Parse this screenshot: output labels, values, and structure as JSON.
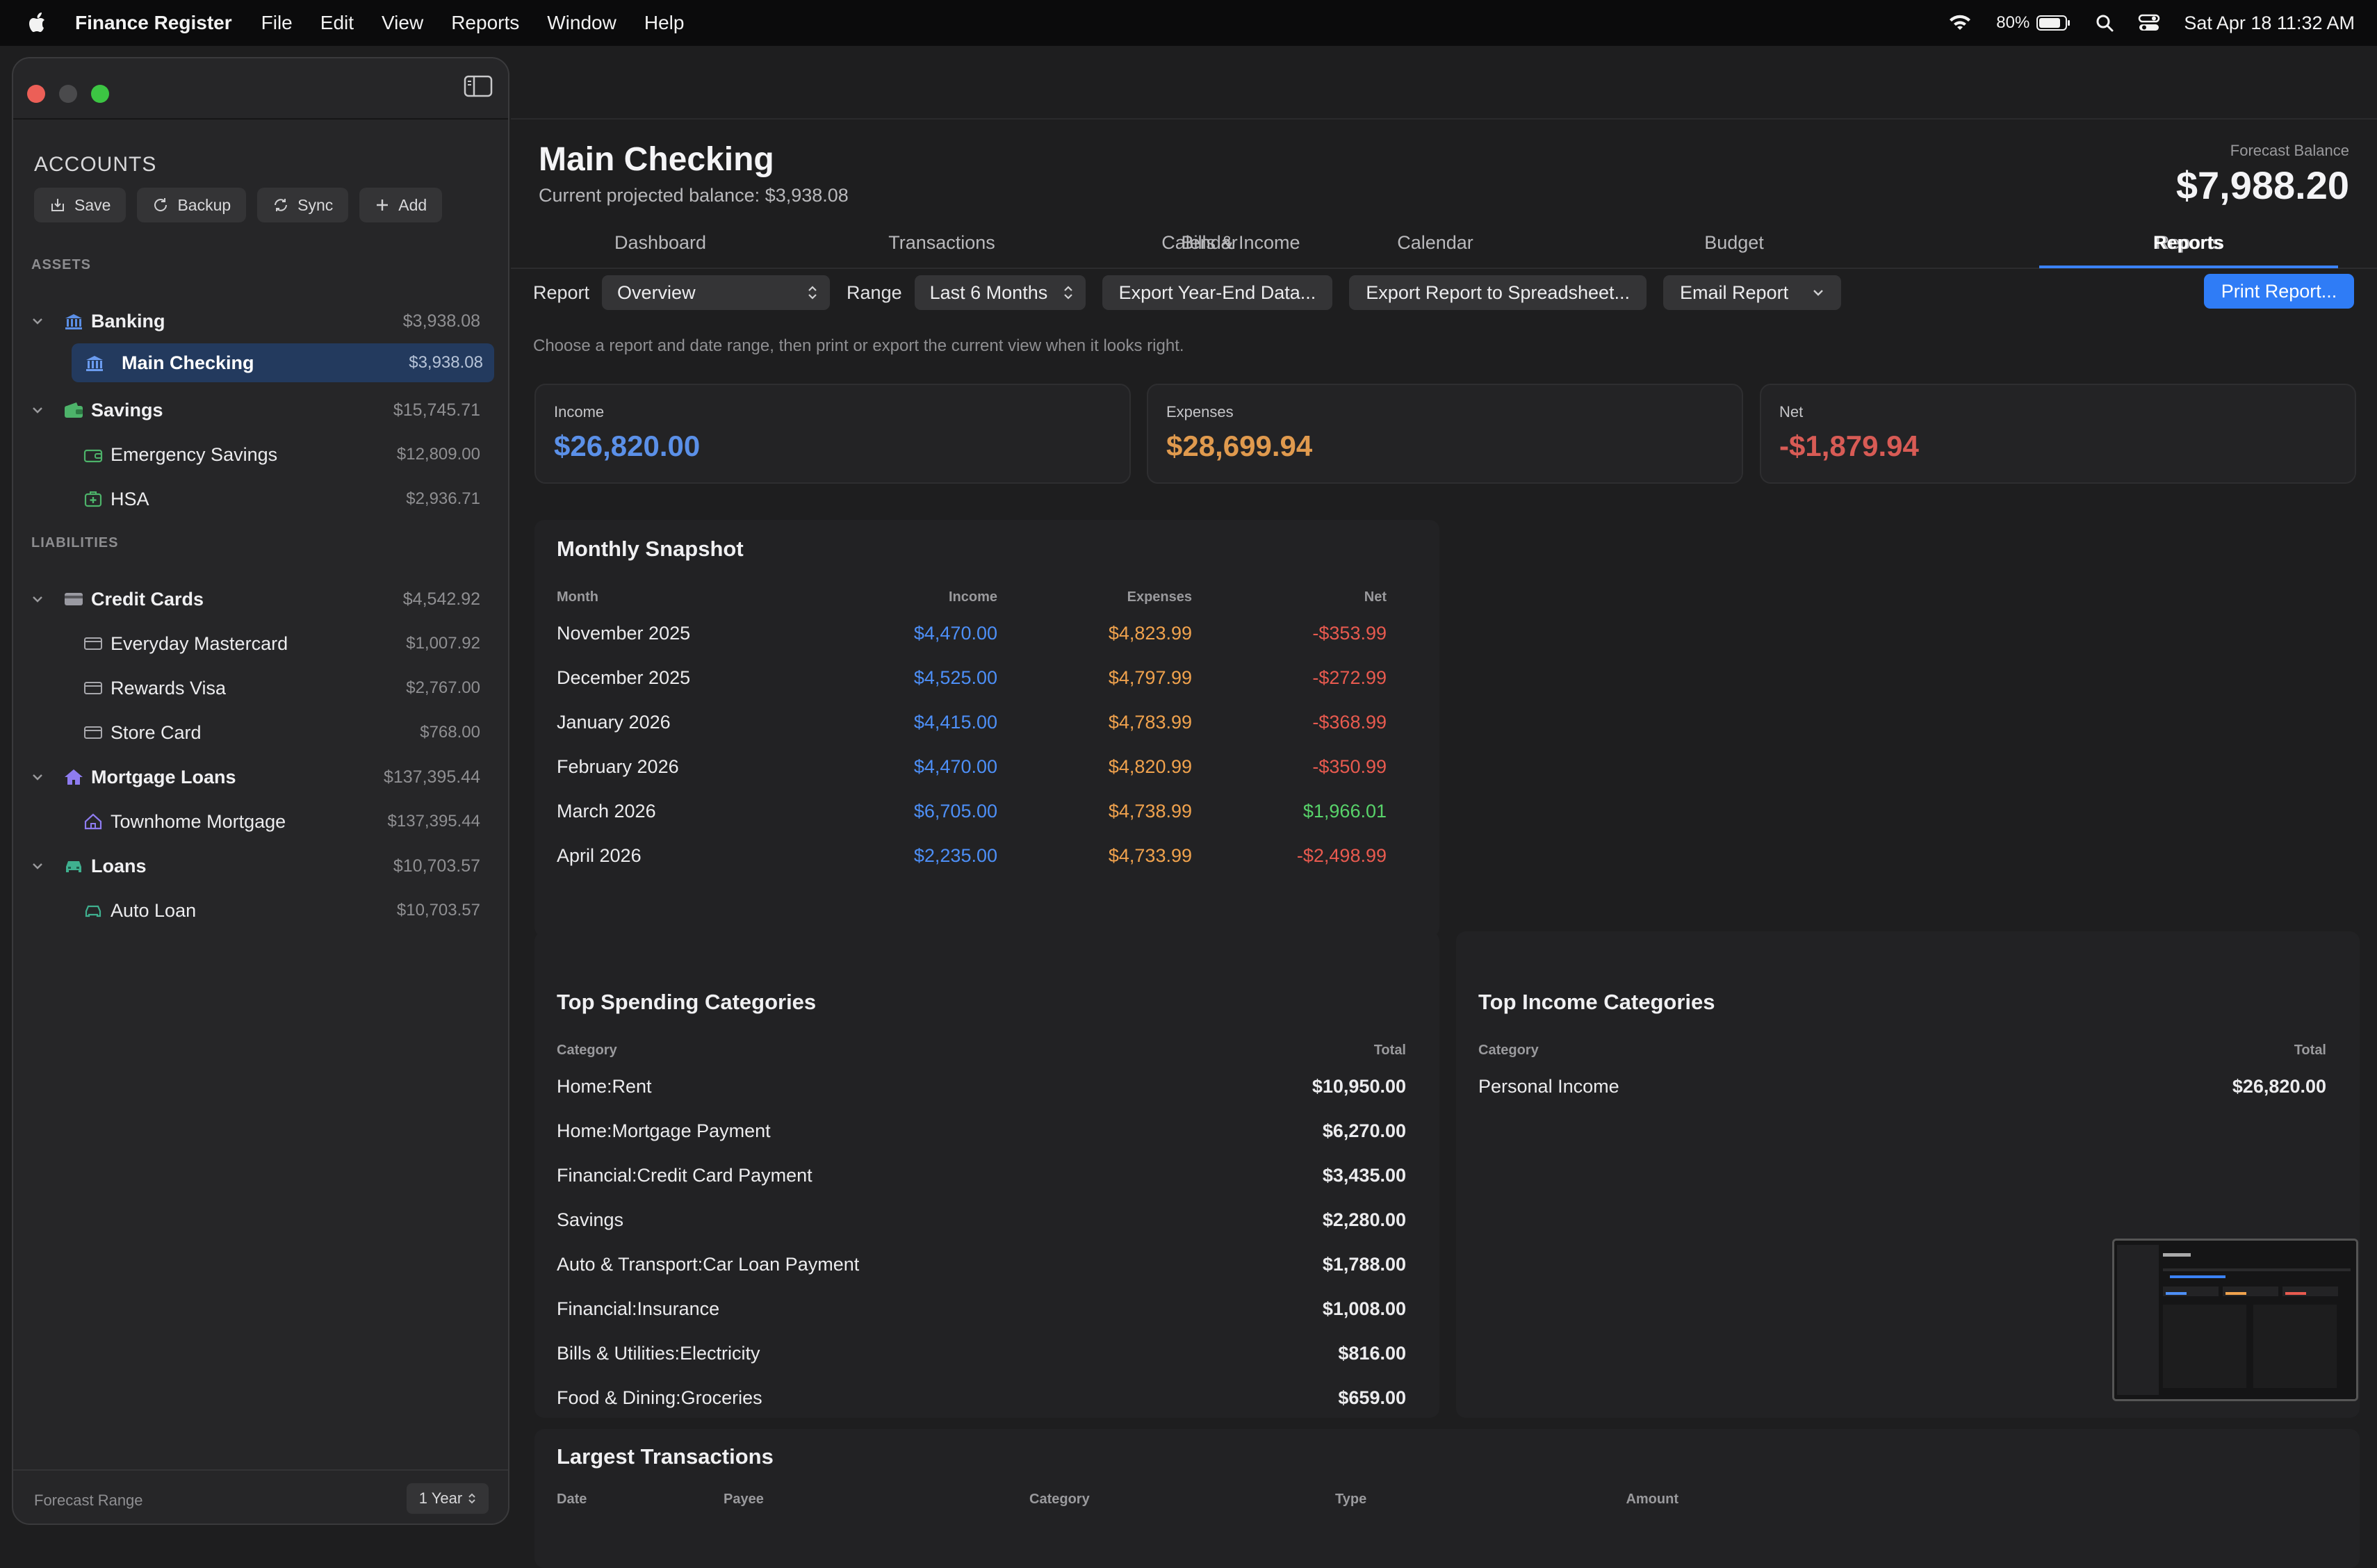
{
  "menubar": {
    "app_name": "Finance Register",
    "menus": [
      "File",
      "Edit",
      "View",
      "Reports",
      "Window",
      "Help"
    ],
    "battery": "80%",
    "datetime": "Sat Apr 18  11:32 AM"
  },
  "sidebar": {
    "title": "ACCOUNTS",
    "toolbar": {
      "save": "Save",
      "backup": "Backup",
      "sync": "Sync",
      "add": "Add"
    },
    "assets_label": "ASSETS",
    "liabilities_label": "LIABILITIES",
    "banking": {
      "label": "Banking",
      "amount": "$3,938.08"
    },
    "main_checking": {
      "label": "Main Checking",
      "amount": "$3,938.08"
    },
    "savings": {
      "label": "Savings",
      "amount": "$15,745.71"
    },
    "emergency_savings": {
      "label": "Emergency Savings",
      "amount": "$12,809.00"
    },
    "hsa": {
      "label": "HSA",
      "amount": "$2,936.71"
    },
    "credit_cards": {
      "label": "Credit Cards",
      "amount": "$4,542.92"
    },
    "everyday_mastercard": {
      "label": "Everyday Mastercard",
      "amount": "$1,007.92"
    },
    "rewards_visa": {
      "label": "Rewards Visa",
      "amount": "$2,767.00"
    },
    "store_card": {
      "label": "Store Card",
      "amount": "$768.00"
    },
    "mortgage_loans": {
      "label": "Mortgage Loans",
      "amount": "$137,395.44"
    },
    "townhome_mortgage": {
      "label": "Townhome Mortgage",
      "amount": "$137,395.44"
    },
    "loans": {
      "label": "Loans",
      "amount": "$10,703.57"
    },
    "auto_loan": {
      "label": "Auto Loan",
      "amount": "$10,703.57"
    },
    "forecast_range_label": "Forecast Range",
    "forecast_range_value": "1 Year"
  },
  "header": {
    "title": "Main Checking",
    "subtitle": "Current projected balance: $3,938.08",
    "forecast_label": "Forecast Balance",
    "forecast_value": "$7,988.20"
  },
  "tabs": [
    "Dashboard",
    "Transactions",
    "Bills & Income",
    "Calendar",
    "Budget",
    "Reports"
  ],
  "controls": {
    "report_label": "Report",
    "report_value": "Overview",
    "range_label": "Range",
    "range_value": "Last 6 Months",
    "export_year_end": "Export Year-End Data...",
    "export_spreadsheet": "Export Report to Spreadsheet...",
    "email_report": "Email Report",
    "print_report": "Print Report..."
  },
  "hint": "Choose a report and date range, then print or export the current view when it looks right.",
  "summary": {
    "income_label": "Income",
    "income_value": "$26,820.00",
    "expenses_label": "Expenses",
    "expenses_value": "$28,699.94",
    "net_label": "Net",
    "net_value": "-$1,879.94"
  },
  "monthly": {
    "title": "Monthly Snapshot",
    "headers": [
      "Month",
      "Income",
      "Expenses",
      "Net"
    ],
    "rows": [
      [
        "November 2025",
        "$4,470.00",
        "$4,823.99",
        "-$353.99"
      ],
      [
        "December 2025",
        "$4,525.00",
        "$4,797.99",
        "-$272.99"
      ],
      [
        "January 2026",
        "$4,415.00",
        "$4,783.99",
        "-$368.99"
      ],
      [
        "February 2026",
        "$4,470.00",
        "$4,820.99",
        "-$350.99"
      ],
      [
        "March 2026",
        "$6,705.00",
        "$4,738.99",
        "$1,966.01"
      ],
      [
        "April 2026",
        "$2,235.00",
        "$4,733.99",
        "-$2,498.99"
      ]
    ]
  },
  "spending": {
    "title": "Top Spending Categories",
    "headers": [
      "Category",
      "Total"
    ],
    "rows": [
      [
        "Home:Rent",
        "$10,950.00"
      ],
      [
        "Home:Mortgage Payment",
        "$6,270.00"
      ],
      [
        "Financial:Credit Card Payment",
        "$3,435.00"
      ],
      [
        "Savings",
        "$2,280.00"
      ],
      [
        "Auto & Transport:Car Loan Payment",
        "$1,788.00"
      ],
      [
        "Financial:Insurance",
        "$1,008.00"
      ],
      [
        "Bills & Utilities:Electricity",
        "$816.00"
      ],
      [
        "Food & Dining:Groceries",
        "$659.00"
      ]
    ]
  },
  "income_cats": {
    "title": "Top Income Categories",
    "headers": [
      "Category",
      "Total"
    ],
    "rows": [
      [
        "Personal Income",
        "$26,820.00"
      ]
    ]
  },
  "largest": {
    "title": "Largest Transactions",
    "headers": [
      "Date",
      "Payee",
      "Category",
      "Type",
      "Amount"
    ]
  },
  "colors": {
    "accent": "#2f7cf6",
    "income": "#4d8ff7",
    "expense": "#f0a24d",
    "negative": "#e85a4f",
    "positive": "#58d36a",
    "selected_row": "#233a5e"
  }
}
